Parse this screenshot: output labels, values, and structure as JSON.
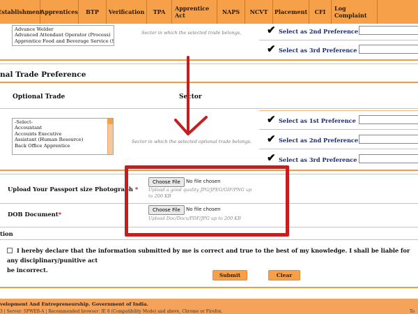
{
  "nav": {
    "items": [
      "Establishment",
      "Apprentices",
      "BTP",
      "Verification",
      "TPA",
      "Apprentice Act",
      "NAPS",
      "NCVT",
      "Placement",
      "CFI",
      "Log Complaint"
    ]
  },
  "top_trade": {
    "options": [
      "Advance Welder",
      "Advanced Attendant Operator (Process)",
      "Apprentice Food and Beverage Service (Stewa"
    ],
    "sector_hint": "Sector in which the selected trade belongs."
  },
  "top_prefs": {
    "second": "Select as 2nd Preference",
    "third": "Select as 3rd Preference"
  },
  "optional": {
    "section_title": "nal Trade Preference",
    "col_trade": "Optional Trade",
    "col_sector": "Sector",
    "options": [
      "-Select-",
      "Accountant",
      "Accounts Executive",
      "Assistant (Human Resource)",
      "Back Office Apprentice"
    ],
    "sector_hint": "Sector in which the selected optional trade belongs.",
    "first": "Select as 1st Preference",
    "second": "Select as 2nd Preference",
    "third": "Select as 3rd Preference"
  },
  "uploads": {
    "photo_label": "Upload Your Passport size Photograph",
    "photo_req": "*",
    "photo_button": "Choose File",
    "photo_status": "No file chosen",
    "photo_hint_1": "Upload a good quality JPG/JPEG/GIF/PNG up",
    "photo_hint_2": "to 200 KB",
    "dob_label": "DOB Document",
    "dob_req": "*",
    "dob_button": "Choose File",
    "dob_status": "No file chosen",
    "dob_hint": "Upload Doc/Docx/PDF/JPG up to 200 KB"
  },
  "declaration": {
    "heading": "tion",
    "text_1": "I hereby declare that the information submitted by me is correct and true to the best of my knowledge. I shall be liable for any disciplinary/punitive act",
    "text_2": "be incorrect."
  },
  "actions": {
    "submit": "Submit",
    "clear": "Clear"
  },
  "footer": {
    "line1": "velopment And Entrepreneurship. Government of India.",
    "line2": "3 | Server: SPWEB-A | Recommended browser: IE 8 (Compatibility Mode) and above, Chrome or Firefox.",
    "right": "To"
  },
  "colors": {
    "accent": "#f7a04a",
    "highlight": "#c41e1e",
    "pref_text": "#1d2a7a"
  }
}
